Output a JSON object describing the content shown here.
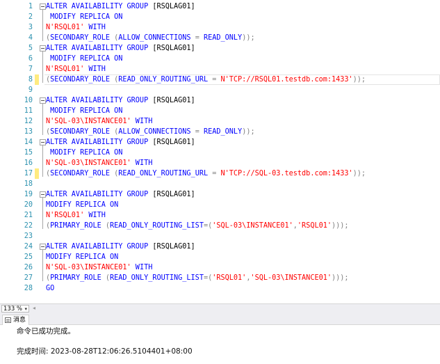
{
  "editor": {
    "lines": [
      {
        "n": "1",
        "fold": true,
        "changed": false,
        "current": false,
        "t": [
          [
            "kw",
            "ALTER AVAILABILITY GROUP "
          ],
          [
            "tx",
            "[RSQLAG01]"
          ]
        ]
      },
      {
        "n": "2",
        "fold": false,
        "changed": false,
        "current": false,
        "t": [
          [
            "kw",
            " MODIFY REPLICA ON"
          ]
        ]
      },
      {
        "n": "3",
        "fold": false,
        "changed": false,
        "current": false,
        "t": [
          [
            "str",
            "N'RSQL01'"
          ],
          [
            "kw",
            " WITH"
          ]
        ]
      },
      {
        "n": "4",
        "fold": false,
        "changed": false,
        "current": false,
        "t": [
          [
            "op",
            "("
          ],
          [
            "kw",
            "SECONDARY_ROLE "
          ],
          [
            "op",
            "("
          ],
          [
            "kw",
            "ALLOW_CONNECTIONS "
          ],
          [
            "op",
            "= "
          ],
          [
            "kw",
            "READ_ONLY"
          ],
          [
            "op",
            "));"
          ]
        ]
      },
      {
        "n": "5",
        "fold": true,
        "changed": false,
        "current": false,
        "t": [
          [
            "kw",
            "ALTER AVAILABILITY GROUP "
          ],
          [
            "tx",
            "[RSQLAG01]"
          ]
        ]
      },
      {
        "n": "6",
        "fold": false,
        "changed": false,
        "current": false,
        "t": [
          [
            "kw",
            " MODIFY REPLICA ON"
          ]
        ]
      },
      {
        "n": "7",
        "fold": false,
        "changed": false,
        "current": false,
        "t": [
          [
            "str",
            "N'RSQL01'"
          ],
          [
            "kw",
            " WITH"
          ]
        ]
      },
      {
        "n": "8",
        "fold": false,
        "changed": true,
        "current": true,
        "t": [
          [
            "op",
            "("
          ],
          [
            "kw",
            "SECONDARY_ROLE "
          ],
          [
            "op",
            "("
          ],
          [
            "kw",
            "READ_ONLY_ROUTING_URL "
          ],
          [
            "op",
            "= "
          ],
          [
            "str",
            "N'TCP://RSQL01.testdb.com:1433'"
          ],
          [
            "op",
            "));"
          ]
        ]
      },
      {
        "n": "9",
        "fold": false,
        "changed": false,
        "current": false,
        "t": []
      },
      {
        "n": "10",
        "fold": true,
        "changed": false,
        "current": false,
        "t": [
          [
            "kw",
            "ALTER AVAILABILITY GROUP "
          ],
          [
            "tx",
            "[RSQLAG01]"
          ]
        ]
      },
      {
        "n": "11",
        "fold": false,
        "changed": false,
        "current": false,
        "t": [
          [
            "kw",
            " MODIFY REPLICA ON"
          ]
        ]
      },
      {
        "n": "12",
        "fold": false,
        "changed": false,
        "current": false,
        "t": [
          [
            "str",
            "N'SQL-03\\INSTANCE01'"
          ],
          [
            "kw",
            " WITH"
          ]
        ]
      },
      {
        "n": "13",
        "fold": false,
        "changed": false,
        "current": false,
        "t": [
          [
            "op",
            "("
          ],
          [
            "kw",
            "SECONDARY_ROLE "
          ],
          [
            "op",
            "("
          ],
          [
            "kw",
            "ALLOW_CONNECTIONS "
          ],
          [
            "op",
            "= "
          ],
          [
            "kw",
            "READ_ONLY"
          ],
          [
            "op",
            "));"
          ]
        ]
      },
      {
        "n": "14",
        "fold": true,
        "changed": false,
        "current": false,
        "t": [
          [
            "kw",
            "ALTER AVAILABILITY GROUP "
          ],
          [
            "tx",
            "[RSQLAG01]"
          ]
        ]
      },
      {
        "n": "15",
        "fold": false,
        "changed": false,
        "current": false,
        "t": [
          [
            "kw",
            " MODIFY REPLICA ON"
          ]
        ]
      },
      {
        "n": "16",
        "fold": false,
        "changed": false,
        "current": false,
        "t": [
          [
            "str",
            "N'SQL-03\\INSTANCE01'"
          ],
          [
            "kw",
            " WITH"
          ]
        ]
      },
      {
        "n": "17",
        "fold": false,
        "changed": true,
        "current": false,
        "t": [
          [
            "op",
            "("
          ],
          [
            "kw",
            "SECONDARY_ROLE "
          ],
          [
            "op",
            "("
          ],
          [
            "kw",
            "READ_ONLY_ROUTING_URL "
          ],
          [
            "op",
            "= "
          ],
          [
            "str",
            "N'TCP://SQL-03.testdb.com:1433'"
          ],
          [
            "op",
            "));"
          ]
        ]
      },
      {
        "n": "18",
        "fold": false,
        "changed": false,
        "current": false,
        "t": []
      },
      {
        "n": "19",
        "fold": true,
        "changed": false,
        "current": false,
        "t": [
          [
            "kw",
            "ALTER AVAILABILITY GROUP "
          ],
          [
            "tx",
            "[RSQLAG01]"
          ]
        ]
      },
      {
        "n": "20",
        "fold": false,
        "changed": false,
        "current": false,
        "t": [
          [
            "kw",
            "MODIFY REPLICA ON"
          ]
        ]
      },
      {
        "n": "21",
        "fold": false,
        "changed": false,
        "current": false,
        "t": [
          [
            "str",
            "N'RSQL01'"
          ],
          [
            "kw",
            " WITH"
          ]
        ]
      },
      {
        "n": "22",
        "fold": false,
        "changed": false,
        "current": false,
        "t": [
          [
            "op",
            "("
          ],
          [
            "kw",
            "PRIMARY_ROLE "
          ],
          [
            "op",
            "("
          ],
          [
            "kw",
            "READ_ONLY_ROUTING_LIST"
          ],
          [
            "op",
            "=("
          ],
          [
            "str",
            "'SQL-03\\INSTANCE01'"
          ],
          [
            "op",
            ","
          ],
          [
            "str",
            "'RSQL01'"
          ],
          [
            "op",
            ")));"
          ]
        ]
      },
      {
        "n": "23",
        "fold": false,
        "changed": false,
        "current": false,
        "t": []
      },
      {
        "n": "24",
        "fold": true,
        "changed": false,
        "current": false,
        "t": [
          [
            "kw",
            "ALTER AVAILABILITY GROUP "
          ],
          [
            "tx",
            "[RSQLAG01]"
          ]
        ]
      },
      {
        "n": "25",
        "fold": false,
        "changed": false,
        "current": false,
        "t": [
          [
            "kw",
            "MODIFY REPLICA ON"
          ]
        ]
      },
      {
        "n": "26",
        "fold": false,
        "changed": false,
        "current": false,
        "t": [
          [
            "str",
            "N'SQL-03\\INSTANCE01'"
          ],
          [
            "kw",
            " WITH"
          ]
        ]
      },
      {
        "n": "27",
        "fold": false,
        "changed": false,
        "current": false,
        "t": [
          [
            "op",
            "("
          ],
          [
            "kw",
            "PRIMARY_ROLE "
          ],
          [
            "op",
            "("
          ],
          [
            "kw",
            "READ_ONLY_ROUTING_LIST"
          ],
          [
            "op",
            "=("
          ],
          [
            "str",
            "'RSQL01'"
          ],
          [
            "op",
            ","
          ],
          [
            "str",
            "'SQL-03\\INSTANCE01'"
          ],
          [
            "op",
            ")));"
          ]
        ]
      },
      {
        "n": "28",
        "fold": false,
        "changed": false,
        "current": false,
        "t": [
          [
            "kw",
            "GO"
          ]
        ]
      }
    ]
  },
  "statusbar": {
    "zoom": "133 %",
    "zoom_arrow": "▾",
    "scroll_left": "◂"
  },
  "results": {
    "tab_label": "消息",
    "message": "命令已成功完成。",
    "completion": "完成时间: 2023-08-28T12:06:26.5104401+08:00"
  },
  "colors": {
    "keyword": "#0000ff",
    "string": "#ff0000",
    "operator": "#808080",
    "line_number": "#2b91af",
    "changed_marker": "#ffeb80"
  }
}
